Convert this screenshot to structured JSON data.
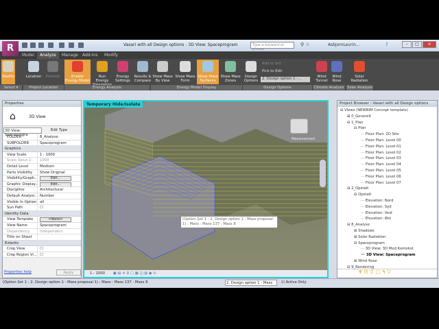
{
  "titlebar": {
    "title": "Vasari with all Design options - 3D View: Spaceprogram",
    "search_placeholder": "Type a keyword or phrase",
    "user": "AsbjornLevrin..."
  },
  "tabs": [
    "Model",
    "Analyze",
    "Manage",
    "Add-Ins",
    "Modify"
  ],
  "active_tab": "Analyze",
  "ribbon": {
    "buttons": [
      {
        "label": "Modify",
        "highlight": true
      },
      {
        "label": "Location"
      },
      {
        "label": "Position",
        "disabled": true
      },
      {
        "label": "Enable Energy Model",
        "highlight": true
      },
      {
        "label": "Run Energy Simulation"
      },
      {
        "label": "Energy Settings"
      },
      {
        "label": "Results & Compare"
      },
      {
        "label": "Show Mass By View"
      },
      {
        "label": "Show Mass Form"
      },
      {
        "label": "Show Mass Surfaces",
        "highlight": true
      },
      {
        "label": "Show Mass Zones"
      },
      {
        "label": "Design Options"
      },
      {
        "label": "Wind Tunnel"
      },
      {
        "label": "Wind Rose"
      },
      {
        "label": "Solar Radiation"
      }
    ],
    "add_to_set": "Add to Set",
    "pick_to_edit": "Pick to Edit",
    "design_option_select": "2. Design option 1 -...",
    "panels": [
      "Select ▾",
      "Project Location",
      "Energy Analysis",
      "Energy Model Display",
      "Design Options",
      "Climate Analysis",
      "Solar Analysis"
    ]
  },
  "properties": {
    "title": "Properties",
    "type": "3D View",
    "selector": "3D View: Spaceprogra",
    "edit_type": "Edit Type",
    "rows_top": [
      [
        "FOLDER",
        "8_Analyse"
      ],
      [
        "SUBFOLDER",
        "Spaceprogram"
      ]
    ],
    "groups": [
      {
        "name": "Graphics",
        "rows": [
          [
            "View Scale",
            "1 : 1000"
          ],
          [
            "Scale Value 1:",
            "1000"
          ],
          [
            "Detail Level",
            "Medium"
          ],
          [
            "Parts Visibility",
            "Show Original"
          ],
          [
            "Visibility/Graph...",
            "Edit..."
          ],
          [
            "Graphic Display...",
            "Edit..."
          ],
          [
            "Discipline",
            "Architectural"
          ],
          [
            "Default Analysi...",
            "Number"
          ],
          [
            "Visible In Option",
            "all"
          ],
          [
            "Sun Path",
            ""
          ]
        ]
      },
      {
        "name": "Identity Data",
        "rows": [
          [
            "View Template",
            "<None>"
          ],
          [
            "View Name",
            "Spaceprogram"
          ],
          [
            "Dependency",
            "Independent"
          ],
          [
            "Title on Sheet",
            ""
          ]
        ]
      },
      {
        "name": "Extents",
        "rows": [
          [
            "Crop View",
            ""
          ],
          [
            "Crop Region Vi...",
            ""
          ]
        ]
      }
    ],
    "help": "Properties help",
    "apply": "Apply"
  },
  "viewport": {
    "label": "Temporary Hide/Isolate",
    "tooltip": "(Option Set 1 : 2. Design option 1 - Mass proposal 1) : Mass : Mass 137 : Mass 8",
    "scale": "1 : 1000",
    "viewcube": "Measurement"
  },
  "browser": {
    "title": "Project Browser - Vasari with all Design options",
    "nodes": [
      [
        "Views (NEWBIM Concept template)",
        0,
        "-"
      ],
      [
        "0_Generelt",
        1,
        "+"
      ],
      [
        "1_Plan",
        1,
        "-"
      ],
      [
        "Plan",
        2,
        "-"
      ],
      [
        "Floor Plan: 2D Site",
        3,
        ""
      ],
      [
        "Floor Plan: Level 00",
        3,
        ""
      ],
      [
        "Floor Plan: Level 01",
        3,
        ""
      ],
      [
        "Floor Plan: Level 02",
        3,
        ""
      ],
      [
        "Floor Plan: Level 03",
        3,
        ""
      ],
      [
        "Floor Plan: Level 04",
        3,
        ""
      ],
      [
        "Floor Plan: Level 05",
        3,
        ""
      ],
      [
        "Floor Plan: Level 06",
        3,
        ""
      ],
      [
        "Floor Plan: Level 07",
        3,
        ""
      ],
      [
        "2_Opstalt",
        1,
        "-"
      ],
      [
        "Opstalt",
        2,
        "-"
      ],
      [
        "Elevation: Nord",
        3,
        ""
      ],
      [
        "Elevation: Syd",
        3,
        ""
      ],
      [
        "Elevation: Vest",
        3,
        ""
      ],
      [
        "Elevation: Øst",
        3,
        ""
      ],
      [
        "8_Analyse",
        1,
        "-"
      ],
      [
        "Shadows",
        2,
        "+"
      ],
      [
        "Solar Radiation",
        2,
        "+"
      ],
      [
        "Spaceprogram",
        2,
        "-"
      ],
      [
        "3D View: 3D Med Kontekst",
        3,
        ""
      ],
      [
        "3D View: Spaceprogram",
        3,
        "",
        true
      ],
      [
        "Wind Rose",
        2,
        "+"
      ],
      [
        "9_Rendering",
        1,
        "-"
      ]
    ]
  },
  "status": {
    "text": "(Option Set 1 : 2. Design option 1 - Mass proposal 1) : Mass : Mass 137 : Mass 8",
    "design_option": "2. Design option 1 - Mass",
    "active_only": "Active Only"
  },
  "colors": {
    "accent": "#e8a040",
    "view_border": "#2ad0d8",
    "ribbon": "#4a4a4a"
  }
}
